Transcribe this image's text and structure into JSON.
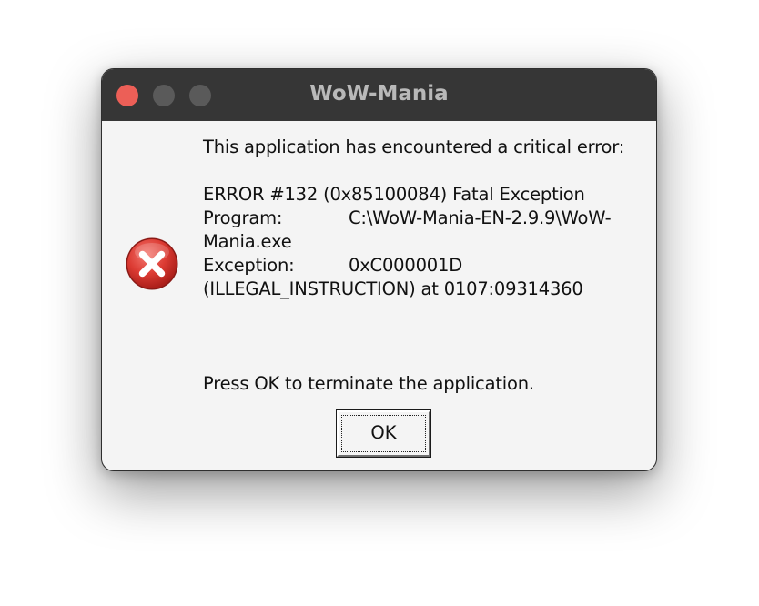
{
  "window": {
    "title": "WoW-Mania"
  },
  "icons": {
    "error": "error-circle-x-icon"
  },
  "colors": {
    "titlebar": "#363636",
    "close_dot": "#ec5f57",
    "inactive_dot": "#5a5a5a",
    "error_red": "#d9302c",
    "dialog_bg": "#f4f4f4"
  },
  "dialog": {
    "intro": "This application has encountered a critical error:",
    "error_line": "ERROR #132 (0x85100084) Fatal Exception",
    "program_label": "Program:",
    "program_value_line1": "C:\\WoW-Mania-EN-2.9.9\\WoW-",
    "program_value_line2": "Mania.exe",
    "exception_label": "Exception:",
    "exception_value": "0xC000001D",
    "exception_detail": "(ILLEGAL_INSTRUCTION) at 0107:09314360",
    "footer": "Press OK to terminate the application.",
    "ok_label": "OK"
  }
}
